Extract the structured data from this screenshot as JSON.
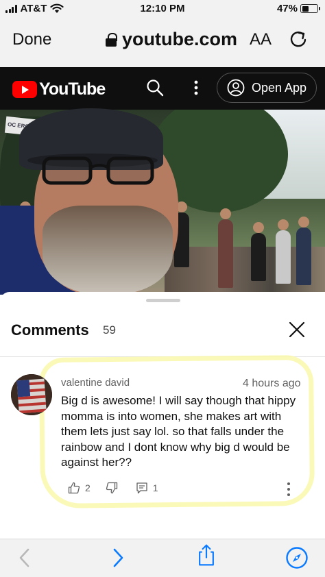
{
  "status_bar": {
    "carrier": "AT&T",
    "time": "12:10 PM",
    "battery_percent": "47%",
    "battery_level": 0.47,
    "icons": [
      "signal-icon",
      "wifi-icon",
      "battery-icon"
    ]
  },
  "safari": {
    "done_label": "Done",
    "url": "youtube.com",
    "text_size_label": "AA",
    "icons": [
      "lock-icon",
      "reload-icon"
    ]
  },
  "youtube_header": {
    "brand": "YouTube",
    "open_app_label": "Open App",
    "icons": [
      "youtube-logo-icon",
      "search-icon",
      "more-vert-icon",
      "account-icon"
    ]
  },
  "video": {
    "banner_text": "OC ERO"
  },
  "comments": {
    "title": "Comments",
    "count": "59",
    "items": [
      {
        "author": "valentine david",
        "time": "4 hours ago",
        "text": "Big d is awesome! I will say though that hippy momma is into women, she makes art with them lets just say lol. so that falls under the rainbow and I dont know why big d would be against her??",
        "likes": "2",
        "replies": "1",
        "icons": [
          "thumb-up-icon",
          "thumb-down-icon",
          "reply-icon",
          "more-vert-icon"
        ]
      }
    ]
  },
  "toolbar": {
    "icons": [
      "back-icon",
      "forward-icon",
      "share-icon",
      "compass-icon"
    ]
  },
  "colors": {
    "youtube_red": "#ff0000",
    "header_bg": "#0f0f0f",
    "safari_blue": "#0a7aff",
    "highlight_yellow": "#faf8aa"
  }
}
